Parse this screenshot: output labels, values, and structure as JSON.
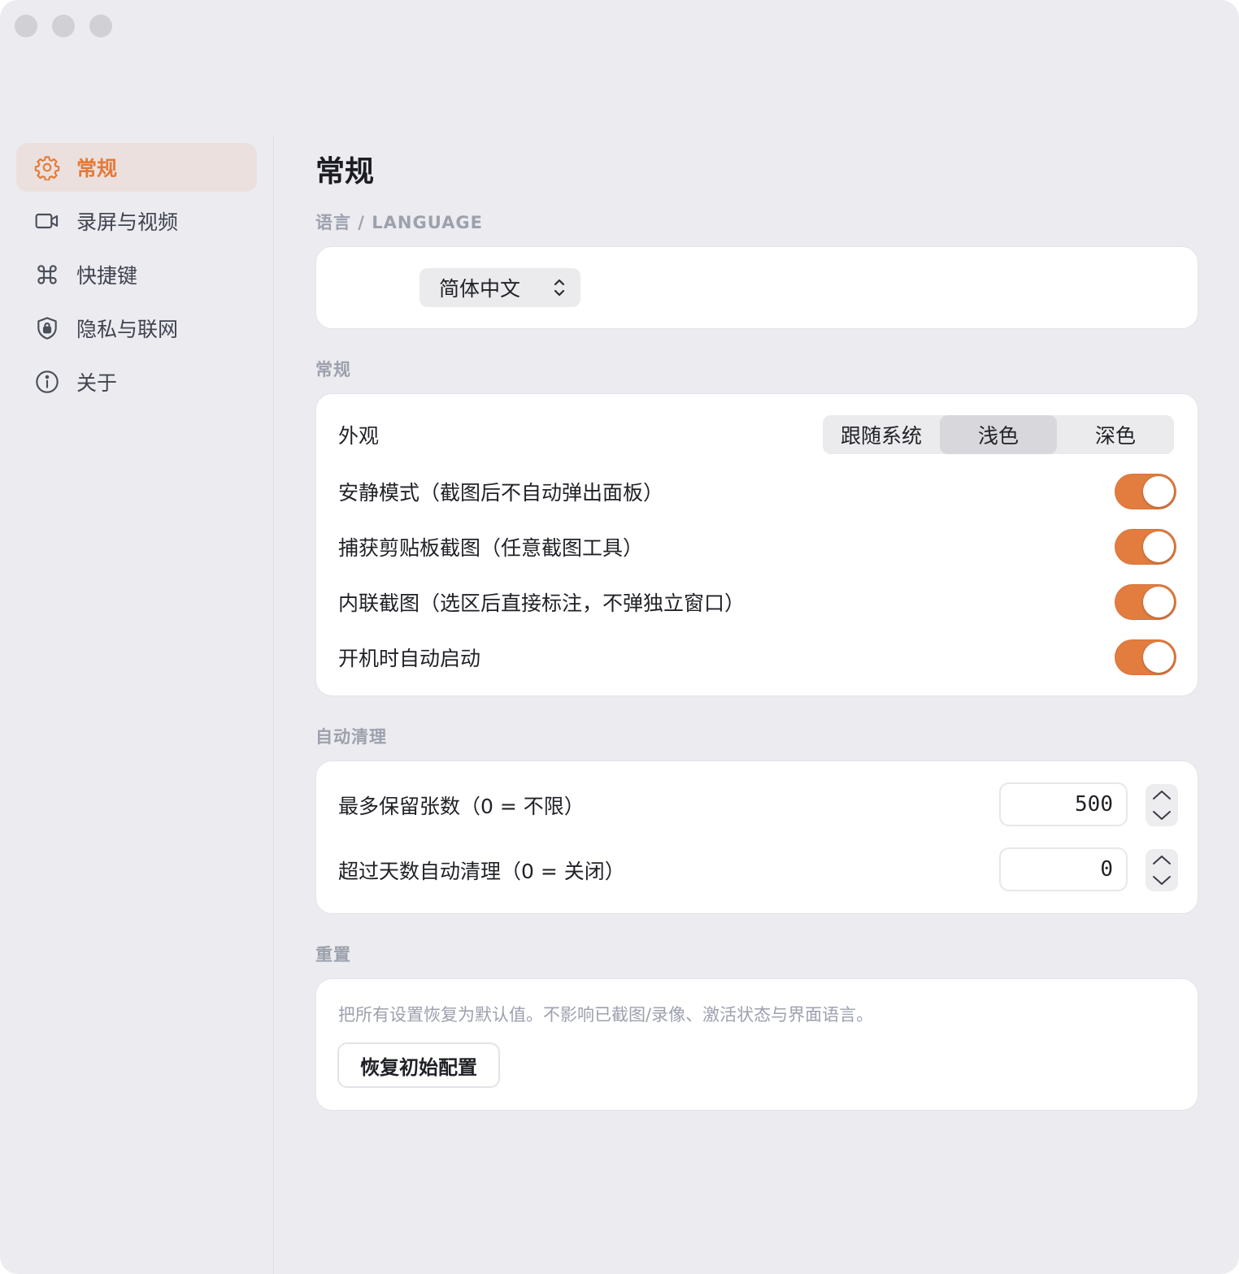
{
  "window": {
    "controls": [
      "close",
      "minimize",
      "zoom"
    ]
  },
  "sidebar": {
    "items": [
      {
        "label": "常规",
        "icon": "gear-icon",
        "active": true
      },
      {
        "label": "录屏与视频",
        "icon": "video-camera-icon",
        "active": false
      },
      {
        "label": "快捷键",
        "icon": "command-key-icon",
        "active": false
      },
      {
        "label": "隐私与联网",
        "icon": "shield-lock-icon",
        "active": false
      },
      {
        "label": "关于",
        "icon": "info-icon",
        "active": false
      }
    ]
  },
  "page": {
    "title": "常规"
  },
  "language": {
    "section_label": "语言 / LANGUAGE",
    "selected": "简体中文"
  },
  "general": {
    "section_label": "常规",
    "appearance": {
      "label": "外观",
      "options": [
        "跟随系统",
        "浅色",
        "深色"
      ],
      "selected": "浅色"
    },
    "toggles": [
      {
        "label": "安静模式（截图后不自动弹出面板）",
        "on": true
      },
      {
        "label": "捕获剪贴板截图（任意截图工具）",
        "on": true
      },
      {
        "label": "内联截图（选区后直接标注，不弹独立窗口）",
        "on": true
      },
      {
        "label": "开机时自动启动",
        "on": true
      }
    ]
  },
  "cleanup": {
    "section_label": "自动清理",
    "max_count": {
      "label": "最多保留张数（0 = 不限）",
      "value": "500"
    },
    "max_days": {
      "label": "超过天数自动清理（0 = 关闭）",
      "value": "0"
    }
  },
  "reset": {
    "section_label": "重置",
    "description": "把所有设置恢复为默认值。不影响已截图/录像、激活状态与界面语言。",
    "button_label": "恢复初始配置"
  },
  "colors": {
    "accent": "#e27c3f",
    "active_bg": "#ece0df",
    "window_bg": "#ecebf0"
  }
}
